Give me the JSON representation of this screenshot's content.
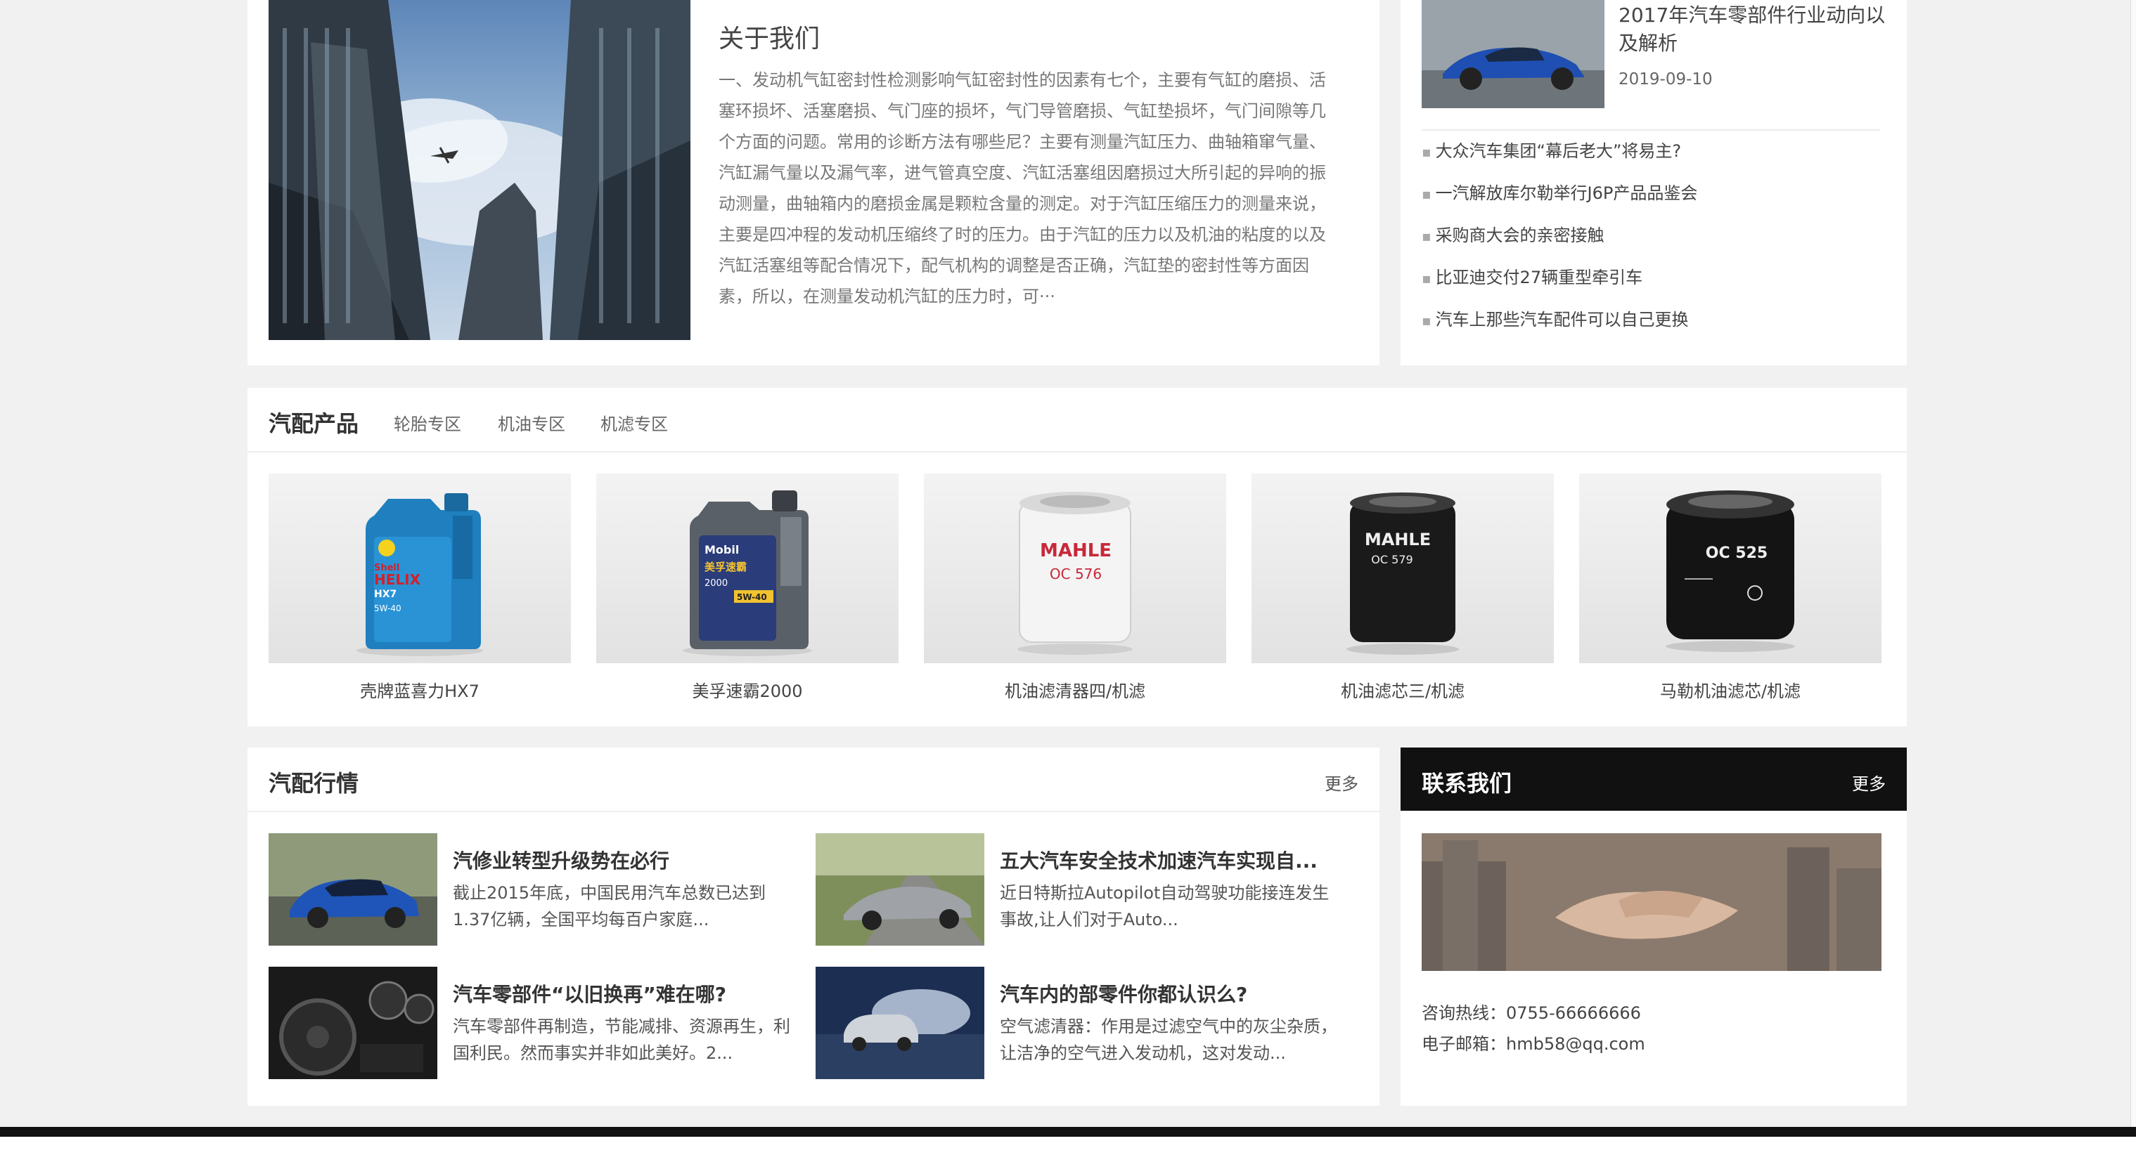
{
  "about": {
    "title": "关于我们",
    "text": "一、发动机气缸密封性检测影响气缸密封性的因素有七个，主要有气缸的磨损、活塞环损坏、活塞磨损、气门座的损坏，气门导管磨损、气缸垫损坏，气门间隙等几个方面的问题。常用的诊断方法有哪些尼？主要有测量汽缸压力、曲轴箱窜气量、汽缸漏气量以及漏气率，进气管真空度、汽缸活塞组因磨损过大所引起的异响的振动测量，曲轴箱内的磨损金属是颗粒含量的测定。对于汽缸压缩压力的测量来说，主要是四冲程的发动机压缩终了时的压力。由于汽缸的压力以及机油的粘度的以及汽缸活塞组等配合情况下，配气机构的调整是否正确，汽缸垫的密封性等方面因素，所以，在测量发动机汽缸的压力时，可···"
  },
  "news_top": {
    "featured_title": "2017年汽车零部件行业动向以及解析",
    "featured_date": "2019-09-10",
    "items": [
      "大众汽车集团“幕后老大”将易主?",
      "一汽解放库尔勒举行J6P产品品鉴会",
      "采购商大会的亲密接触",
      "比亚迪交付27辆重型牵引车",
      "汽车上那些汽车配件可以自己更换"
    ]
  },
  "products": {
    "heading": "汽配产品",
    "tabs": [
      "轮胎专区",
      "机油专区",
      "机滤专区"
    ],
    "items": [
      {
        "name": "壳牌蓝喜力HX7"
      },
      {
        "name": "美孚速霸2000"
      },
      {
        "name": "机油滤清器四/机滤"
      },
      {
        "name": "机油滤芯三/机滤"
      },
      {
        "name": "马勒机油滤芯/机滤"
      }
    ],
    "label_texts": {
      "shell_brand": "Shell",
      "shell_line": "HELIX",
      "shell_model": "HX7",
      "shell_grade": "5W-40",
      "mobil_brand": "Mobil",
      "mobil_cn": "美孚速霸",
      "mobil_num": "2000",
      "mobil_grade": "5W-40",
      "mahle": "MAHLE",
      "f1_model": "OC 576",
      "f2_model": "OC 579",
      "f3_model": "OC 525"
    }
  },
  "industry": {
    "heading": "汽配行情",
    "more": "更多",
    "articles": [
      {
        "title": "汽修业转型升级势在必行",
        "desc": "截止2015年底，中国民用汽车总数已达到1.37亿辆，全国平均每百户家庭..."
      },
      {
        "title": "五大汽车安全技术加速汽车实现自...",
        "desc": "近日特斯拉Autopilot自动驾驶功能接连发生事故,让人们对于Auto..."
      },
      {
        "title": "汽车零部件“以旧换再”难在哪?",
        "desc": "汽车零部件再制造，节能减排、资源再生，利国利民。然而事实并非如此美好。2..."
      },
      {
        "title": "汽车内的部零件你都认识么?",
        "desc": "空气滤清器：作用是过滤空气中的灰尘杂质，让洁净的空气进入发动机，这对发动..."
      }
    ]
  },
  "contact": {
    "heading": "联系我们",
    "more": "更多",
    "hotline": "咨询热线：0755-66666666",
    "email": "电子邮箱：hmb58@qq.com"
  },
  "colors": {
    "page_bg": "#f1f1f1",
    "panel_bg": "#ffffff",
    "contact_header_bg": "#111111",
    "footer_bar": "#111111"
  }
}
